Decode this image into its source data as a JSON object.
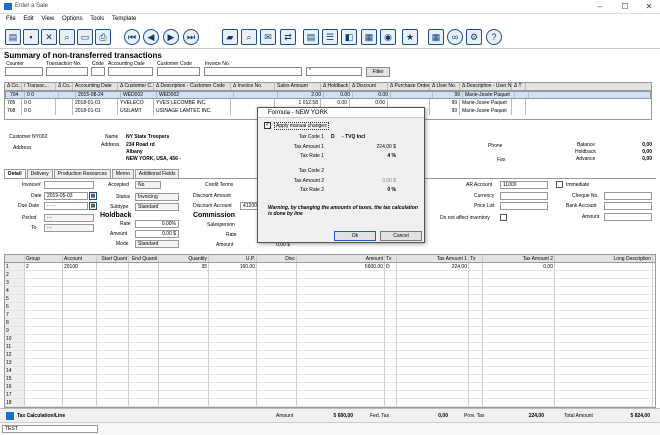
{
  "window": {
    "title": "Enter a Sale",
    "minimize": "–",
    "maximize": "☐",
    "close": "✕"
  },
  "menu": [
    "File",
    "Edit",
    "View",
    "Options",
    "Tools",
    "Template"
  ],
  "toolbar_icons": [
    "new-document-icon",
    "save-icon",
    "delete-icon",
    "find-icon",
    "print-preview-icon",
    "print-icon",
    "first-record-icon",
    "previous-record-icon",
    "next-record-icon",
    "last-record-icon",
    "open-folder-icon",
    "folder-search-icon",
    "email-icon",
    "transfer-icon",
    "document-icon",
    "document-list-icon",
    "split-icon",
    "calculator-icon",
    "customer-icon",
    "star-menu-icon",
    "grid-icon",
    "link-icon",
    "settings-icon",
    "help-icon"
  ],
  "summary": {
    "title": "Summary of non-transferred transactions",
    "filters": {
      "counter": "Counter",
      "transaction_no": "Transaction No.",
      "code": "Code",
      "accounting_date": "Accounting Date",
      "customer_code": "Customer Code",
      "invoice_no": "Invoice No.",
      "invoice_value": "*",
      "filter_button": "Filter"
    },
    "columns": [
      "Δ Co...",
      "/ Transac...",
      "Δ Co...",
      "Accounting Date",
      "Δ Customer C...",
      "Δ Description - Customer Code",
      "Δ Invoice No.",
      "Sales Amount",
      "Δ Holdback",
      "Δ Discount",
      "Δ Purchase Order",
      "Δ User No.",
      "Δ Description - User No.",
      "Δ T"
    ],
    "rows": [
      [
        "704",
        "0 0",
        "",
        "2015-08-24",
        "WED002",
        "WED002",
        "",
        "2.00",
        "0.00",
        "0.00",
        "",
        "99",
        "Marie-Josée Paquet",
        ""
      ],
      [
        "705",
        "0 0",
        "",
        "2018-01-01",
        "YVELECO",
        "YVES LECOMBE INC.",
        "",
        "1 012.58",
        "0.00",
        "0.00",
        "",
        "99",
        "Marie-Josée Paquet",
        ""
      ],
      [
        "708",
        "0 0",
        "",
        "2018-01-01",
        "USILAMT",
        "USINAGE LAMTEC INC.",
        "",
        "",
        "0.00",
        "0.00",
        "",
        "99",
        "Marie-Josée Paquet",
        ""
      ]
    ]
  },
  "customer": {
    "customer_label": "Customer NY002",
    "name_label": "Name",
    "name_value": "NY State Troopers",
    "address_label": "Address",
    "address_label2": "Address",
    "address_lines": [
      "234 Road rd",
      "Albany",
      "NEW YORK, USA, 456  -"
    ],
    "phone_label": "Phone",
    "fax_label": "Fax",
    "balance_label": "Balance",
    "balance_value": "0,00",
    "holdback_label": "Holdback",
    "holdback_value": "0,00",
    "advance_label": "Advance",
    "advance_value": "0,00"
  },
  "tabs": [
    "Detail",
    "Delivery",
    "Production Resources",
    "Memo",
    "Additional Fields"
  ],
  "form": {
    "invoice_label": "Invoice#",
    "date_label": "Date",
    "date_value": "2019-05-03",
    "due_date_label": "Due Date",
    "due_date_value": "- - -",
    "period_label": "Period",
    "period_value": "- -",
    "to_label": "To",
    "to_value": "- -",
    "accepted_label": "Accepted",
    "accepted_value": "No",
    "status_label": "Status",
    "status_value": "Invoicing",
    "subtype_label": "Subtype",
    "subtype_value": "Standard",
    "holdback_head": "Holdback",
    "rate_label": "Rate",
    "rate_value": "0,00%",
    "amount_label": "Amount",
    "amount_value": "0,00 $",
    "mode_label": "Mode",
    "mode_value": "Standard",
    "credit_terms_label": "Credit Terms",
    "discount_amount_label": "Discount Amount",
    "discount_account_label": "Discount Account",
    "discount_account_value": "41200",
    "commission_head": "Commission",
    "salesperson_label": "Salesperson",
    "comm_rate_label": "Rate",
    "comm_amount_label": "Amount",
    "comm_amount_value": "0,00 $",
    "ar_account_label": "AR Account",
    "ar_account_value": "11000",
    "currency_label": "Currency",
    "price_list_label": "Price List",
    "immediate_label": "Immediate",
    "cheque_no_label": "Cheque No.",
    "bank_account_label": "Bank Account",
    "bank_amount_label": "Amount",
    "dnai_label": "Do not affect inventory"
  },
  "lines": {
    "columns": [
      "",
      "Group",
      "Account",
      "Start Quant",
      "End Quanti",
      "Quantity",
      "U.P.",
      "Disc",
      "Amount",
      "Tx",
      "Tax Amount 1",
      "Tx",
      "Tax Amount 2",
      "Long Description"
    ],
    "first_row": [
      "1",
      "2",
      "20100",
      "",
      "",
      "35",
      "160.00",
      "",
      "5600.00",
      "D",
      "224.00",
      "",
      "0.00",
      ""
    ],
    "row_numbers": [
      "2",
      "3",
      "4",
      "5",
      "6",
      "7",
      "8",
      "9",
      "10",
      "11",
      "12",
      "13",
      "14",
      "15",
      "16",
      "17",
      "18",
      "19"
    ]
  },
  "bottom": {
    "tax_calc": "Tax Calculation/Line",
    "amount_label": "Amount",
    "amount_value": "5 600,00",
    "fed_tax_label": "Fed. Tax",
    "fed_tax_value": "0,00",
    "prov_tax_label": "Prov. Tax",
    "prov_tax_value": "224,00",
    "total_label": "Total Amount",
    "total_value": "5 824,00"
  },
  "status": {
    "field_value": "TEST"
  },
  "dialog": {
    "title": "Formula - NEW YORK",
    "apply_label": "Apply manual changes",
    "tax_code1_label": "Tax Code 1",
    "tax_code1_value": "D",
    "tax_code1_desc": "- TVQ Incl",
    "tax_amount1_label": "Tax Amount 1",
    "tax_amount1_value": "224,00 $",
    "tax_rate1_label": "Tax Rate 1",
    "tax_rate1_value": "4 %",
    "tax_code2_label": "Tax Code 2",
    "tax_amount2_label": "Tax Amount 2",
    "tax_amount2_value": "0,00 $",
    "tax_rate2_label": "Tax Rate 2",
    "tax_rate2_value": "0 %",
    "warning": "Warning, by changing the amounts of taxes, the tax calculation is done by line",
    "ok": "Ok",
    "cancel": "Cancel"
  }
}
